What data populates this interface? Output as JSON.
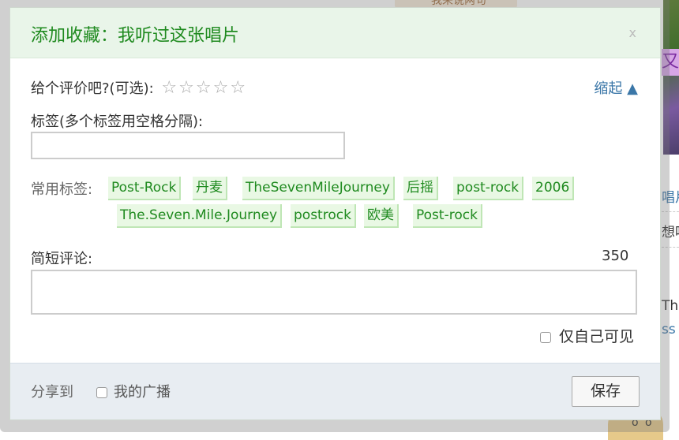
{
  "background": {
    "top_button_text": "我来说两句",
    "photo_label": "又",
    "right_texts": [
      "唱片",
      "想听",
      "The",
      "ss"
    ]
  },
  "dialog": {
    "title": "添加收藏：我听过这张唱片",
    "close_label": "x",
    "rating_label": "给个评价吧?(可选):",
    "stars": [
      "☆",
      "☆",
      "☆",
      "☆",
      "☆"
    ],
    "collapse_label": "缩起 ▲",
    "tags_label": "标签(多个标签用空格分隔):",
    "tags_input_value": "",
    "common_tags_label": "常用标签:",
    "common_tags": [
      "Post-Rock",
      "丹麦",
      "TheSevenMileJourney",
      "后摇",
      "post-rock",
      "2006",
      "The.Seven.Mile.Journey",
      "postrock",
      "欧美",
      "Post-rock"
    ],
    "comment_label": "简短评论:",
    "char_count": "350",
    "comment_value": "",
    "private_label": "仅自己可见",
    "share_label": "分享到",
    "broadcast_label": "我的广播",
    "save_label": "保存"
  },
  "colors": {
    "title_green": "#1f8a1f",
    "link_blue": "#3b77a8",
    "header_bg": "#e9f5e9",
    "footer_bg": "#e8edf2",
    "tag_bg": "#e9f8e4"
  }
}
